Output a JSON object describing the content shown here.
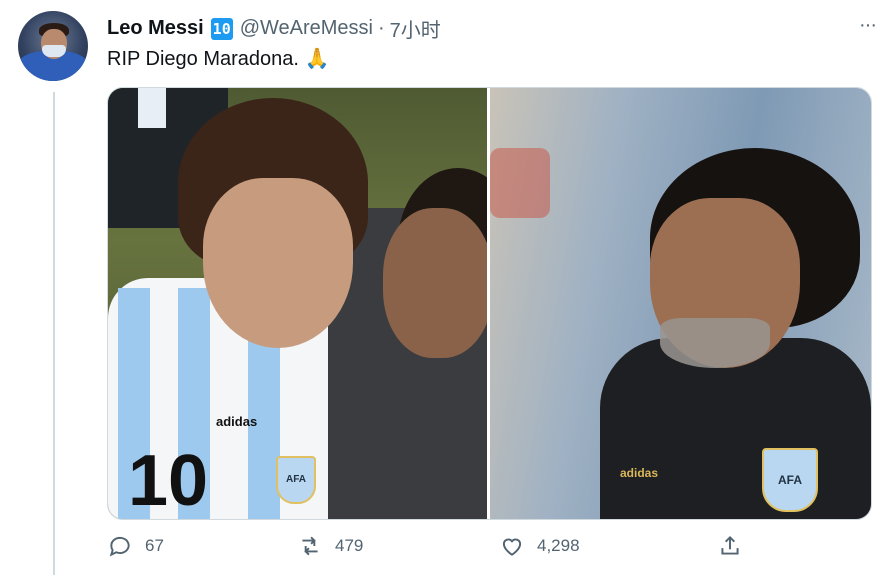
{
  "tweet": {
    "author_name": "Leo Messi",
    "verified_badge": "10",
    "handle": "@WeAreMessi",
    "separator": "·",
    "time": "7小时",
    "text": "RIP Diego Maradona. 🙏",
    "more_label": "···"
  },
  "media": {
    "left_photo": {
      "jersey_brand": "adidas",
      "jersey_number": "10",
      "crest_text": "AFA"
    },
    "right_photo": {
      "jacket_brand": "adidas",
      "crest_text": "AFA"
    }
  },
  "actions": {
    "reply_count": "67",
    "retweet_count": "479",
    "like_count": "4,298"
  },
  "icons": [
    "avatar",
    "verified-badge-icon",
    "more-icon",
    "reply-icon",
    "retweet-icon",
    "like-icon",
    "share-icon"
  ],
  "colors": {
    "accent": "#1d9bf0",
    "muted": "#536471",
    "border": "#cfd9de"
  }
}
